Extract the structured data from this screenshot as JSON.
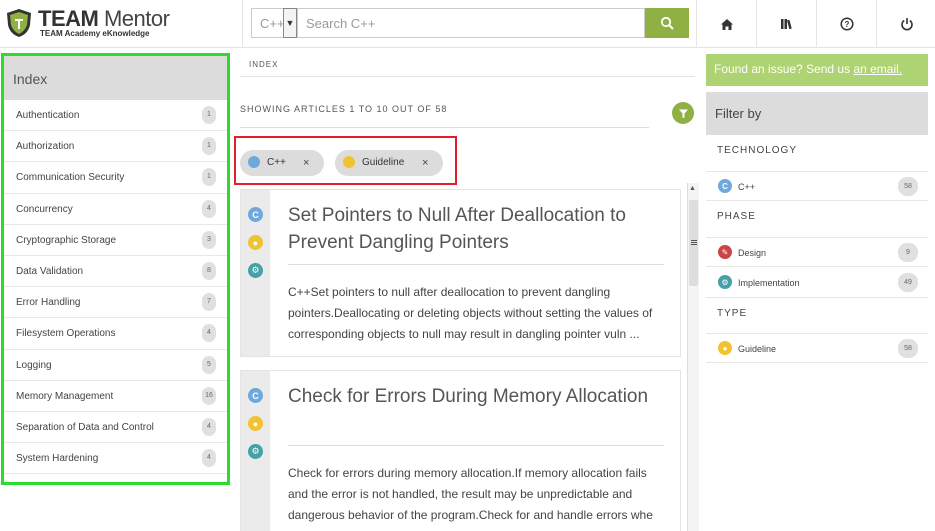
{
  "header": {
    "logo_title_bold": "TEAM",
    "logo_title_rest": " Mentor",
    "logo_subtitle": "TEAM Academy eKnowledge",
    "search_scope": "C++",
    "search_placeholder": "Search C++",
    "nav_icons": [
      "home-icon",
      "library-icon",
      "help-icon",
      "power-icon"
    ]
  },
  "index": {
    "title": "Index",
    "items": [
      {
        "label": "Authentication",
        "count": "1"
      },
      {
        "label": "Authorization",
        "count": "1"
      },
      {
        "label": "Communication Security",
        "count": "1"
      },
      {
        "label": "Concurrency",
        "count": "4"
      },
      {
        "label": "Cryptographic Storage",
        "count": "3"
      },
      {
        "label": "Data Validation",
        "count": "8"
      },
      {
        "label": "Error Handling",
        "count": "7"
      },
      {
        "label": "Filesystem Operations",
        "count": "4"
      },
      {
        "label": "Logging",
        "count": "5"
      },
      {
        "label": "Memory Management",
        "count": "16"
      },
      {
        "label": "Separation of Data and Control",
        "count": "4"
      },
      {
        "label": "System Hardening",
        "count": "4"
      }
    ]
  },
  "main": {
    "breadcrumb": "INDEX",
    "showing": "SHOWING ARTICLES 1 TO 10 OUT OF 58",
    "chips": [
      {
        "label": "C++",
        "close": "×",
        "icon": "cpp-icon",
        "color": "#6fa8dc"
      },
      {
        "label": "Guideline",
        "close": "×",
        "icon": "guideline-icon",
        "color": "#f1c232"
      }
    ],
    "articles": [
      {
        "title": "Set Pointers to Null After Deallocation to Prevent Dangling Pointers",
        "summary": "C++Set pointers to null after deallocation to prevent dangling pointers.Deallocating or deleting objects without setting the values of corresponding objects to null may result in dangling pointer vuln ..."
      },
      {
        "title": "Check for Errors During Memory Allocation",
        "summary": "Check for errors during memory allocation.If memory allocation fails and the error is not handled, the result may be unpredictable and dangerous behavior of the program.Check for and handle errors whe ..."
      }
    ]
  },
  "right": {
    "issue_text": "Found an issue? Send us ",
    "issue_link": "an email.",
    "filter_title": "Filter by",
    "sections": [
      {
        "title": "TECHNOLOGY",
        "rows": [
          {
            "label": "C++",
            "count": "58",
            "icon": "cpp-icon",
            "color": "#6fa8dc"
          }
        ]
      },
      {
        "title": "PHASE",
        "rows": [
          {
            "label": "Design",
            "count": "9",
            "icon": "design-icon",
            "color": "#cc4444"
          },
          {
            "label": "Implementation",
            "count": "49",
            "icon": "implementation-icon",
            "color": "#45a0a8"
          }
        ]
      },
      {
        "title": "TYPE",
        "rows": [
          {
            "label": "Guideline",
            "count": "58",
            "icon": "guideline-icon",
            "color": "#f1c232"
          }
        ]
      }
    ]
  },
  "colors": {
    "accent_green": "#8fb043",
    "issue_green": "#aed373",
    "highlight_green": "#2cdc2c",
    "highlight_red": "#e2202a"
  }
}
